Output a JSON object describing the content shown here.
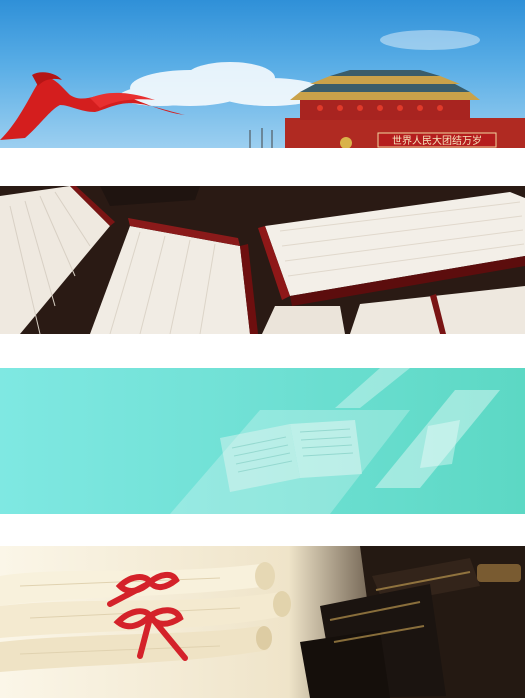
{
  "panels": [
    {
      "id": "tiananmen-banner",
      "sign_text": "世界人民大团结万岁"
    },
    {
      "id": "books-banner"
    },
    {
      "id": "teal-book-banner"
    },
    {
      "id": "diploma-banner"
    }
  ],
  "colors": {
    "sky": "#4aa3e2",
    "flag_red": "#d41e1e",
    "gate_wall": "#b02a22",
    "roof_gold": "#c9a24a",
    "teal": "#6fe0d4",
    "ribbon_red": "#d4222a",
    "book_dark": "#2a1a14"
  },
  "icons": [
    "red-ribbon-flag",
    "tiananmen-gate",
    "open-book",
    "rolled-diploma",
    "leather-books"
  ]
}
